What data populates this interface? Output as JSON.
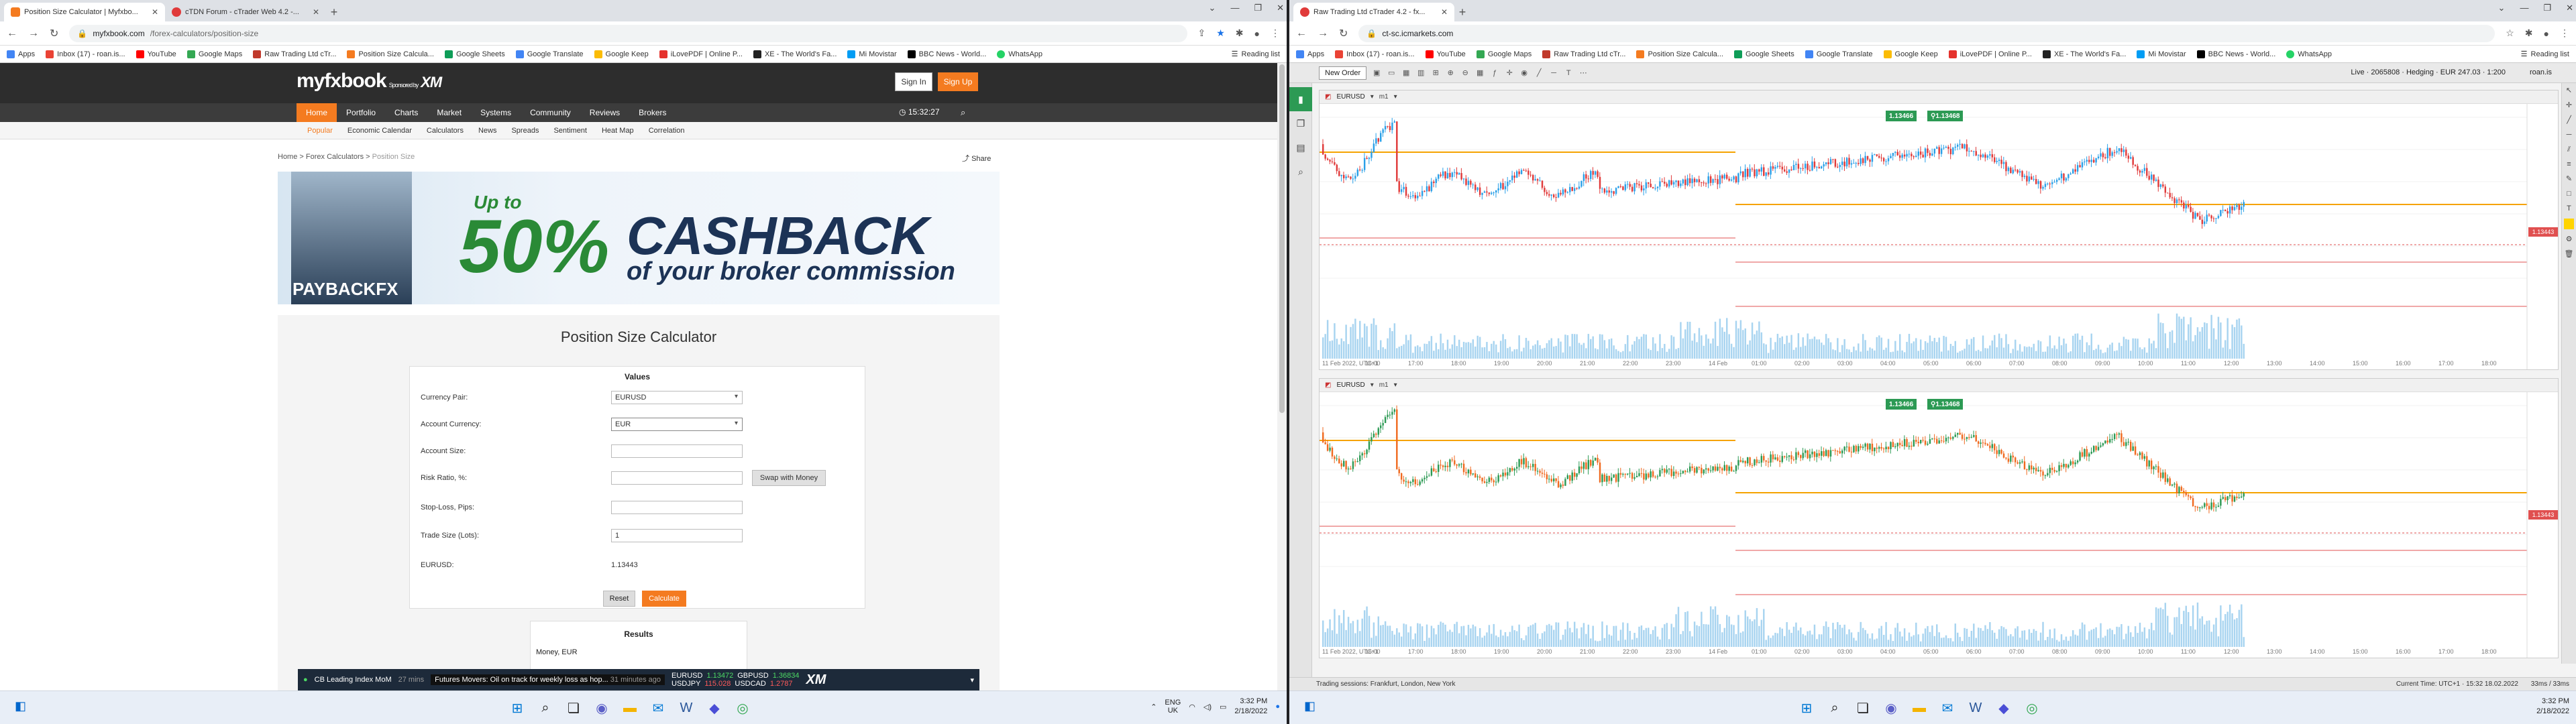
{
  "left": {
    "tabs": [
      {
        "title": "Position Size Calculator | Myfxbo...",
        "active": true
      },
      {
        "title": "cTDN Forum - cTrader Web 4.2 -...",
        "active": false
      }
    ],
    "url": {
      "host": "myfxbook.com",
      "path": "/forex-calculators/position-size"
    },
    "bookmarks": [
      "Apps",
      "Inbox (17) - roan.is...",
      "YouTube",
      "Google Maps",
      "Raw Trading Ltd cTr...",
      "Position Size Calcula...",
      "Google Sheets",
      "Google Translate",
      "Google Keep",
      "iLovePDF | Online P...",
      "XE - The World's Fa...",
      "Mi Movistar",
      "BBC News - World...",
      "WhatsApp"
    ],
    "reading_list": "Reading list",
    "site": {
      "logo": "myfxbook",
      "sponsor": "Sponsored by",
      "sponsor_brand": "XM",
      "signin": "Sign In",
      "signup": "Sign Up",
      "nav": [
        "Home",
        "Portfolio",
        "Charts",
        "Market",
        "Systems",
        "Community",
        "Reviews",
        "Brokers"
      ],
      "time": "15:32:27",
      "subnav": [
        "Popular",
        "Economic Calendar",
        "Calculators",
        "News",
        "Spreads",
        "Sentiment",
        "Heat Map",
        "Correlation"
      ],
      "breadcrumb": {
        "home": "Home",
        "sep": ">",
        "section": "Forex Calculators",
        "current": "Position Size"
      },
      "share": "Share"
    },
    "banner": {
      "up_to": "Up to",
      "pct": "50%",
      "cashback": "CASHBACK",
      "sub": "of your broker commission",
      "payback": "PAYBACKFX"
    },
    "calculator": {
      "title": "Position Size Calculator",
      "values_header": "Values",
      "labels": [
        "Currency Pair:",
        "Account Currency:",
        "Account Size:",
        "Risk Ratio, %:",
        "Stop-Loss, Pips:",
        "Trade Size (Lots):",
        "EURUSD:"
      ],
      "currency_pair": "EURUSD",
      "account_currency": "EUR",
      "account_size": "",
      "risk_ratio": "",
      "stop_loss": "",
      "trade_size": "1",
      "eurusd_rate": "1.13443",
      "swap_button": "Swap with Money",
      "reset": "Reset",
      "calculate": "Calculate",
      "results_header": "Results",
      "money_label": "Money, EUR"
    },
    "ticker": {
      "item1": "CB Leading Index MoM",
      "item1_time": "27 mins",
      "headline": "Futures Movers: Oil on track for weekly loss as hop...",
      "headline_time": "31 minutes ago",
      "pairs": [
        {
          "sym": "EURUSD",
          "bid": "1.13472",
          "ask": "1.36834",
          "pair2": "GBPUSD"
        },
        {
          "sym": "USDJPY",
          "bid": "115.028",
          "ask": "1.2787",
          "pair2": "USDCAD"
        }
      ],
      "brand": "XM"
    }
  },
  "right": {
    "tabs": [
      {
        "title": "Raw Trading Ltd cTrader 4.2 - fx...",
        "active": true
      }
    ],
    "url": {
      "host": "ct-sc.icmarkets.com",
      "path": ""
    },
    "bookmarks": [
      "Apps",
      "Inbox (17) - roan.is...",
      "YouTube",
      "Google Maps",
      "Raw Trading Ltd cTr...",
      "Position Size Calcula...",
      "Google Sheets",
      "Google Translate",
      "Google Keep",
      "iLovePDF | Online P...",
      "XE - The World's Fa...",
      "Mi Movistar",
      "BBC News - World...",
      "WhatsApp"
    ],
    "reading_list": "Reading list",
    "ctrader": {
      "new_order": "New Order",
      "account": "Live · 2065808 · Hedging · EUR 247.03 · 1:200",
      "user": "roan.is",
      "charts": [
        {
          "symbol": "EURUSD",
          "timeframe": "m1",
          "bid": "1.13466",
          "ask": "1.13468",
          "price_tag": "1.13443"
        },
        {
          "symbol": "EURUSD",
          "timeframe": "m1",
          "bid": "1.13466",
          "ask": "1.13468",
          "price_tag": "1.13443"
        }
      ],
      "x_labels": [
        "11 Feb 2022, UTC+1",
        "16:00",
        "17:00",
        "18:00",
        "19:00",
        "20:00",
        "21:00",
        "22:00",
        "23:00",
        "14 Feb",
        "01:00",
        "02:00",
        "03:00",
        "04:00",
        "05:00",
        "06:00",
        "07:00",
        "08:00",
        "09:00",
        "10:00",
        "11:00",
        "12:00",
        "13:00",
        "14:00",
        "15:00",
        "16:00",
        "17:00",
        "18:00"
      ],
      "status_left": "Trading sessions: Frankfurt, London, New York",
      "status_right": "Current Time:  UTC+1 · 15:32 18.02.2022",
      "latency": "33ms / 33ms"
    }
  },
  "taskbar": {
    "lang": "ENG",
    "region": "UK",
    "time": "3:32 PM",
    "date": "2/18/2022",
    "right_time": "3:32 PM",
    "right_date": "2/18/2022"
  }
}
